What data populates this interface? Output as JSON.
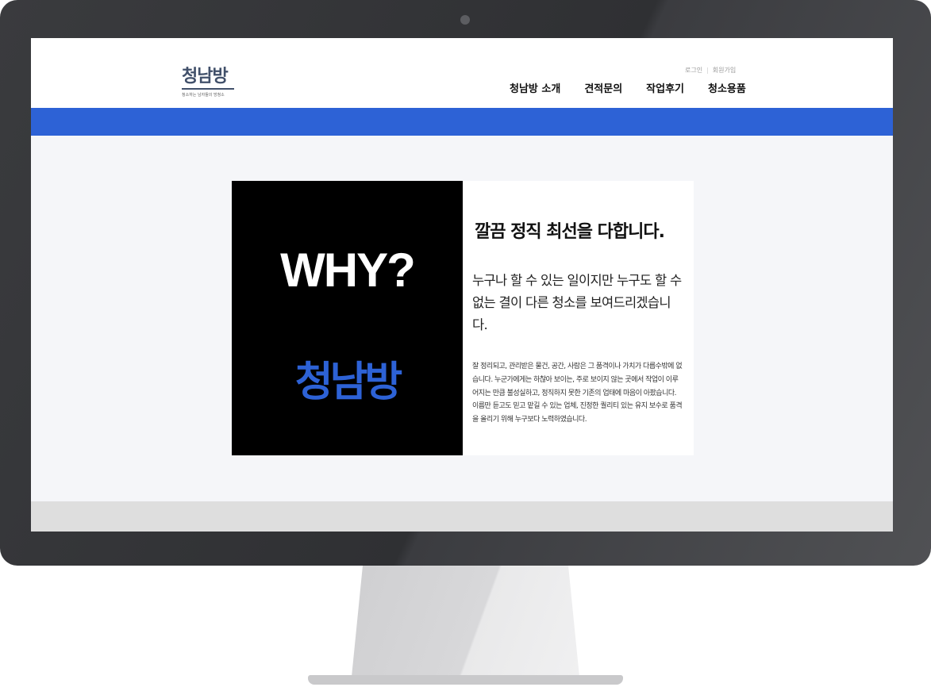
{
  "header": {
    "logo": {
      "title": "청남방",
      "subtitle": "청소하는 남자들의 방청소"
    },
    "utility": {
      "login": "로그인",
      "signup": "회원가입"
    },
    "nav": [
      {
        "label": "청남방 소개"
      },
      {
        "label": "견적문의"
      },
      {
        "label": "작업후기"
      },
      {
        "label": "청소용품"
      }
    ]
  },
  "hero": {
    "why": "WHY?",
    "brand": "청남방",
    "headline": "깔끔 정직 최선을 다합니다.",
    "lead": "누구나 할 수 있는 일이지만 누구도 할 수 없는 결이 다른 청소를 보여드리겠습니다.",
    "body": "잘 정리되고, 관리받은 물건, 공간, 사람은 그 품격이나 가치가 다릅수밖에 없습니다. 누군가에게는 하찮아 보이는, 주로 보이지 않는 곳에서 작업이 이루어지는 만큼 불성실하고, 정직하지 못한 기존의 업태에 마음이 아팠습니다. 이름만 듣고도 믿고 맡길 수 있는 업체, 진정한 퀄리티 있는 유지 보수로 품격을 올리기 위해 누구보다 노력하였습니다."
  },
  "colors": {
    "accent": "#2d62d6",
    "logo": "#41506a",
    "page_background": "#f5f6f9"
  }
}
